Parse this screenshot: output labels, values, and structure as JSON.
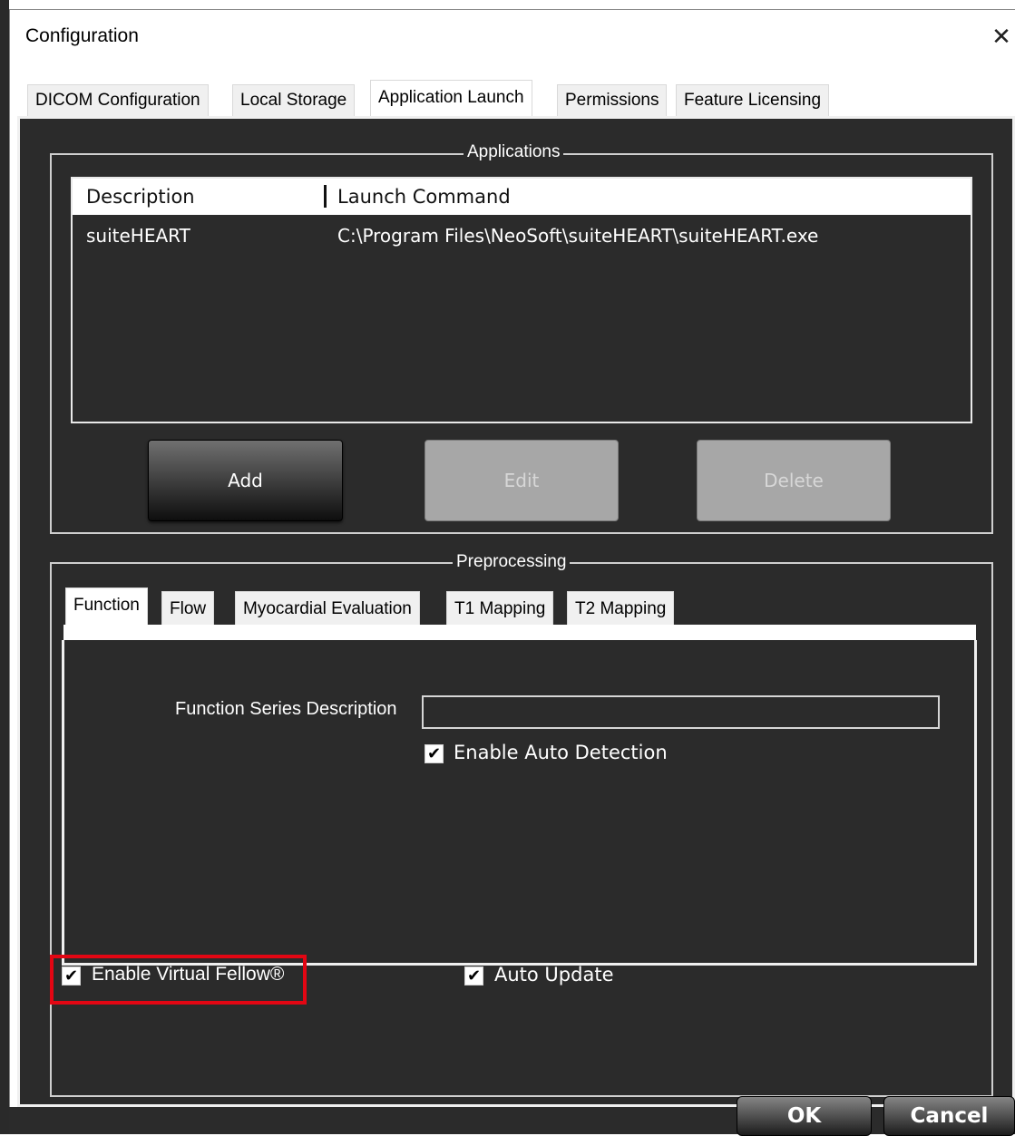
{
  "window": {
    "title": "Configuration",
    "close_glyph": "✕"
  },
  "tabs": [
    {
      "label": "DICOM Configuration"
    },
    {
      "label": "Local Storage"
    },
    {
      "label": "Application Launch",
      "active": true
    },
    {
      "label": "Permissions"
    },
    {
      "label": "Feature Licensing"
    }
  ],
  "applications": {
    "group_title": "Applications",
    "columns": [
      "Description",
      "Launch Command"
    ],
    "rows": [
      {
        "description": "suiteHEART",
        "command": "C:\\Program Files\\NeoSoft\\suiteHEART\\suiteHEART.exe"
      }
    ],
    "buttons": {
      "add": "Add",
      "edit": "Edit",
      "delete": "Delete"
    },
    "edit_enabled": false,
    "delete_enabled": false
  },
  "preprocessing": {
    "group_title": "Preprocessing",
    "tabs": [
      {
        "label": "Function",
        "active": true
      },
      {
        "label": "Flow"
      },
      {
        "label": "Myocardial Evaluation"
      },
      {
        "label": "T1 Mapping"
      },
      {
        "label": "T2 Mapping"
      }
    ],
    "function_series_label": "Function Series Description",
    "function_series_value": "",
    "auto_detection": {
      "label": "Enable Auto Detection",
      "checked": true
    },
    "virtual_fellow": {
      "label": "Enable Virtual Fellow®",
      "checked": true
    },
    "auto_update": {
      "label": "Auto Update",
      "checked": true
    }
  },
  "footer": {
    "ok": "OK",
    "cancel": "Cancel"
  },
  "colors": {
    "panel": "#2b2b2b",
    "highlight": "#e30613"
  },
  "icons": {
    "check": "✔"
  }
}
